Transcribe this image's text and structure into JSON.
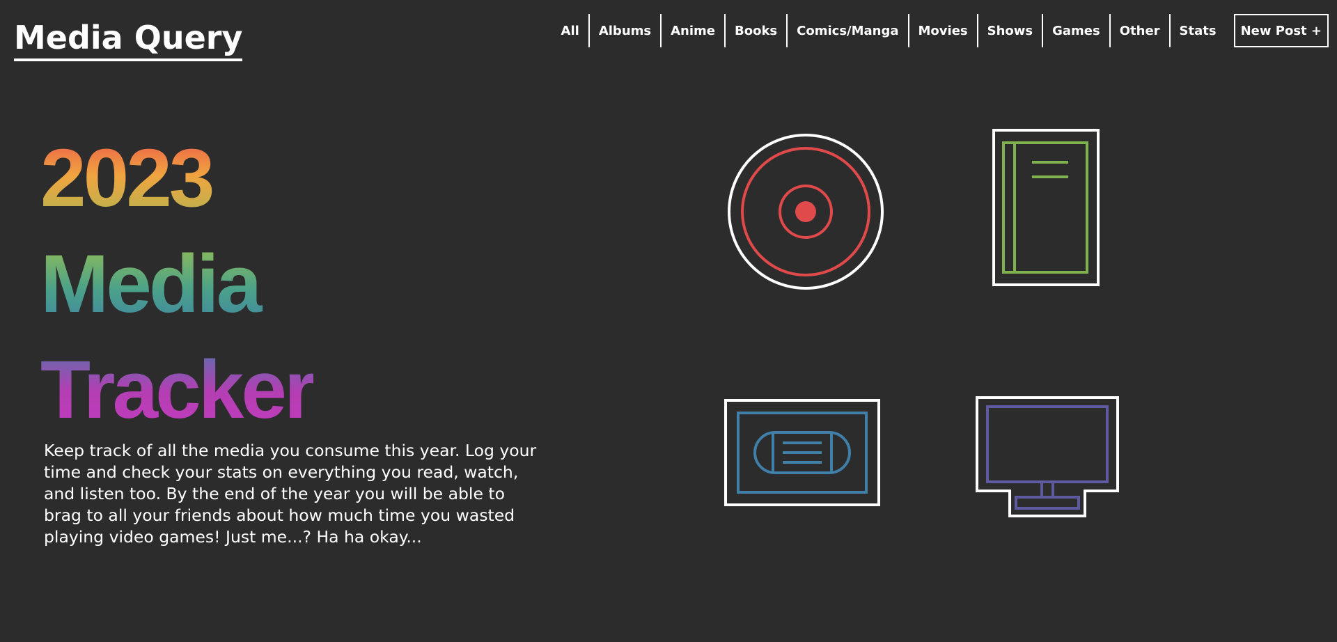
{
  "brand": "Media Query",
  "nav": {
    "items": [
      "All",
      "Albums",
      "Anime",
      "Books",
      "Comics/Manga",
      "Movies",
      "Shows",
      "Games",
      "Other",
      "Stats"
    ],
    "new_post": "New Post +"
  },
  "hero": {
    "line1": "2023",
    "line2": "Media",
    "line3": "Tracker",
    "description": "Keep track of all the media you consume this year. Log your time and check your stats on everything you read, watch, and listen too. By the end of the year you will be able to brag to all your friends about how much time you wasted playing video games! Just me...? Ha ha okay..."
  },
  "icons": [
    "disc-icon",
    "book-icon",
    "vhs-tape-icon",
    "tv-icon"
  ],
  "colors": {
    "background": "#2c2c2c",
    "red": "#e04a4a",
    "green": "#7fb24d",
    "blue": "#3f7fa8",
    "purple": "#5e5aa0"
  }
}
